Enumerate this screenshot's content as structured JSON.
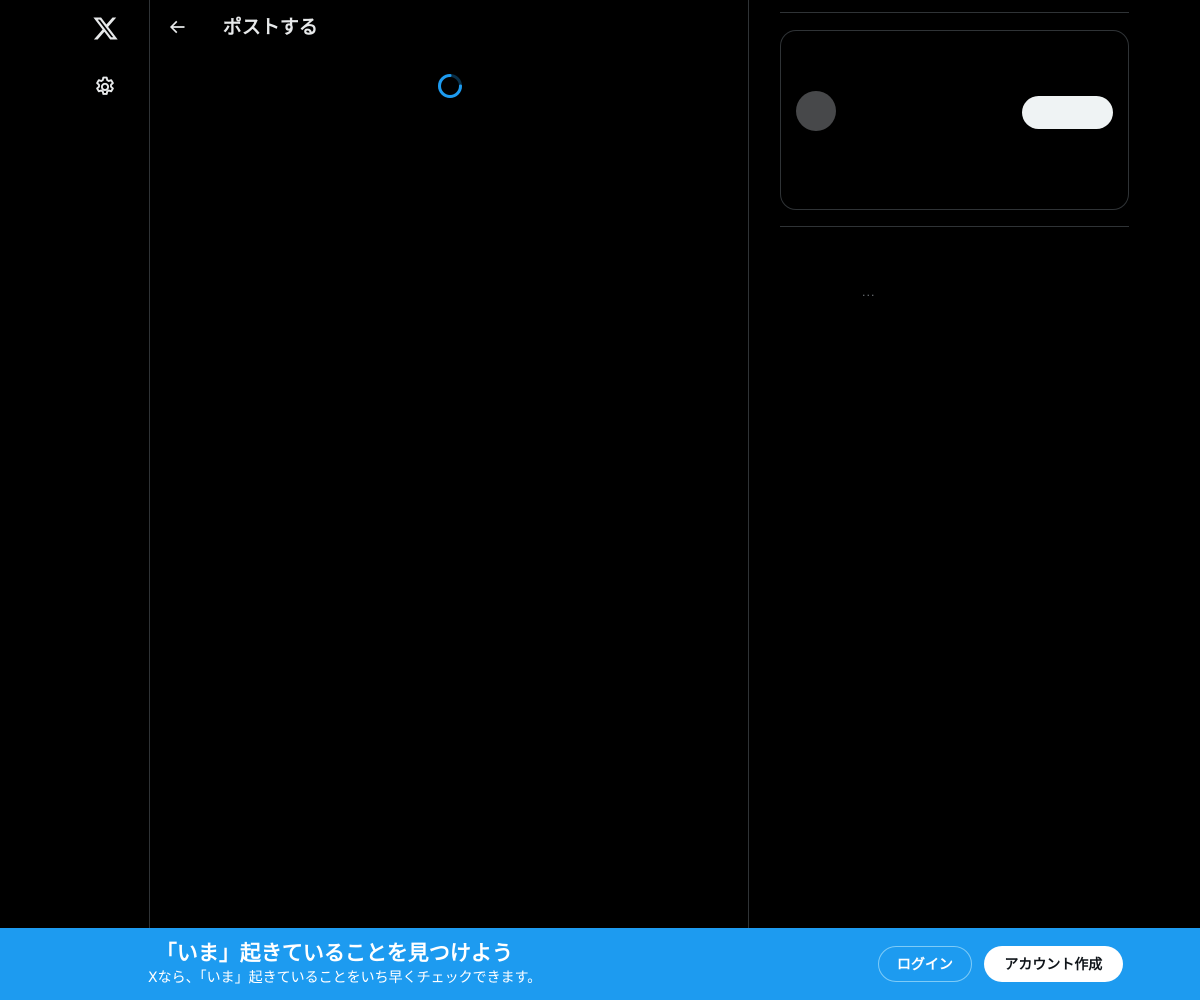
{
  "nav": {
    "logo_icon": "x-logo-icon",
    "settings_icon": "gear-icon"
  },
  "main": {
    "back_icon": "arrow-left-icon",
    "title": "ポストする",
    "loading_icon": "spinner-icon"
  },
  "sidebar": {
    "ellipsis": "..."
  },
  "banner": {
    "headline": "「いま」起きていることを見つけよう",
    "subtext": "Xなら、「いま」起きていることをいち早くチェックできます。",
    "login_label": "ログイン",
    "signup_label": "アカウント作成"
  },
  "colors": {
    "background": "#000000",
    "text": "#e7e9ea",
    "border": "#2f3336",
    "accent": "#1d9bf0",
    "button_light": "#eff3f4",
    "avatar_placeholder": "#47484a"
  }
}
